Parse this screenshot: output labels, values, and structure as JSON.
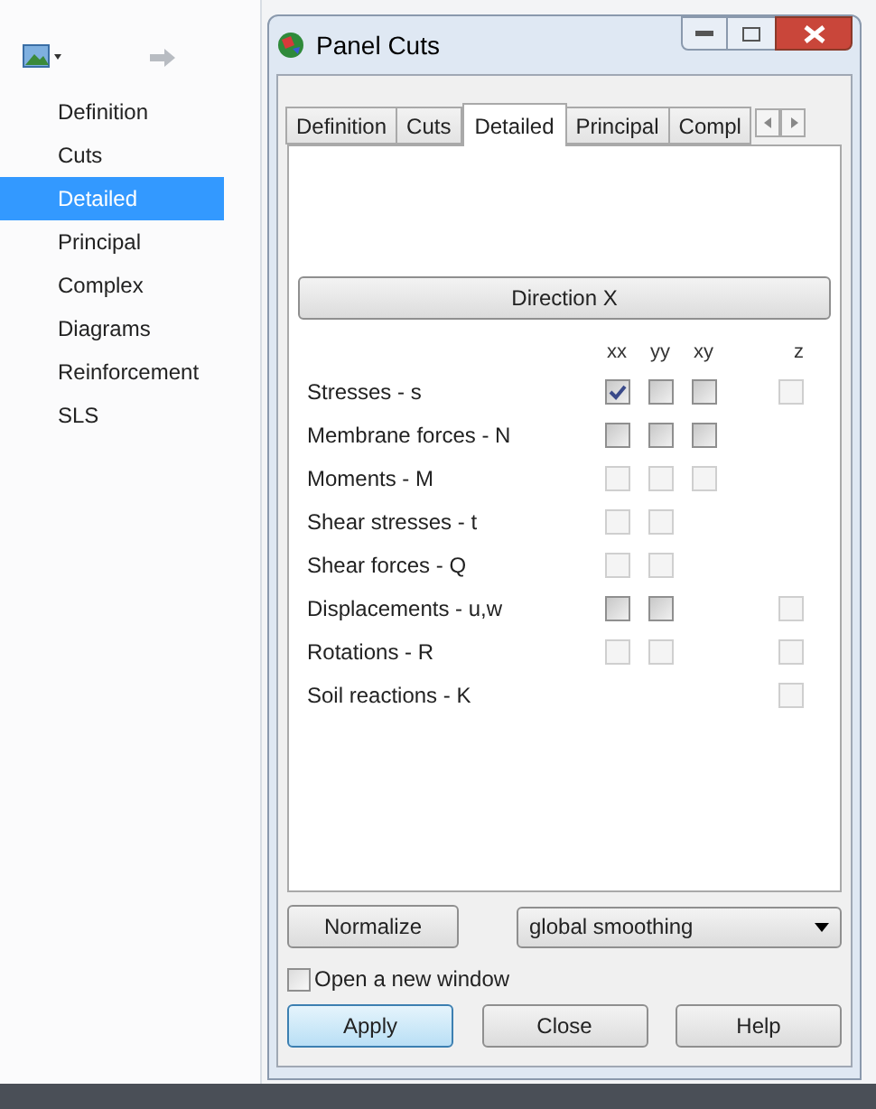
{
  "sidebar": {
    "items": [
      {
        "label": "Definition",
        "selected": false
      },
      {
        "label": "Cuts",
        "selected": false
      },
      {
        "label": "Detailed",
        "selected": true
      },
      {
        "label": "Principal",
        "selected": false
      },
      {
        "label": "Complex",
        "selected": false
      },
      {
        "label": "Diagrams",
        "selected": false
      },
      {
        "label": "Reinforcement",
        "selected": false
      },
      {
        "label": "SLS",
        "selected": false
      }
    ]
  },
  "window": {
    "title": "Panel Cuts"
  },
  "tabs": [
    {
      "label": "Definition",
      "selected": false
    },
    {
      "label": "Cuts",
      "selected": false
    },
    {
      "label": "Detailed",
      "selected": true
    },
    {
      "label": "Principal",
      "selected": false
    },
    {
      "label": "Compl",
      "selected": false
    }
  ],
  "direction_button": "Direction X",
  "columns": [
    "xx",
    "yy",
    "xy",
    "z"
  ],
  "rows": [
    {
      "label": "Stresses - s",
      "cells": [
        {
          "kind": "checkbox",
          "checked": true,
          "disabled": false
        },
        {
          "kind": "checkbox",
          "checked": false,
          "disabled": false
        },
        {
          "kind": "checkbox",
          "checked": false,
          "disabled": false
        },
        {
          "kind": "checkbox",
          "checked": false,
          "disabled": true
        }
      ]
    },
    {
      "label": "Membrane forces - N",
      "cells": [
        {
          "kind": "checkbox",
          "checked": false,
          "disabled": false
        },
        {
          "kind": "checkbox",
          "checked": false,
          "disabled": false
        },
        {
          "kind": "checkbox",
          "checked": false,
          "disabled": false
        },
        {
          "kind": "none"
        }
      ]
    },
    {
      "label": "Moments - M",
      "cells": [
        {
          "kind": "checkbox",
          "checked": false,
          "disabled": true
        },
        {
          "kind": "checkbox",
          "checked": false,
          "disabled": true
        },
        {
          "kind": "checkbox",
          "checked": false,
          "disabled": true
        },
        {
          "kind": "none"
        }
      ]
    },
    {
      "label": "Shear stresses - t",
      "cells": [
        {
          "kind": "checkbox",
          "checked": false,
          "disabled": true
        },
        {
          "kind": "checkbox",
          "checked": false,
          "disabled": true
        },
        {
          "kind": "none"
        },
        {
          "kind": "none"
        }
      ]
    },
    {
      "label": "Shear forces - Q",
      "cells": [
        {
          "kind": "checkbox",
          "checked": false,
          "disabled": true
        },
        {
          "kind": "checkbox",
          "checked": false,
          "disabled": true
        },
        {
          "kind": "none"
        },
        {
          "kind": "none"
        }
      ]
    },
    {
      "label": "Displacements - u,w",
      "cells": [
        {
          "kind": "checkbox",
          "checked": false,
          "disabled": false
        },
        {
          "kind": "checkbox",
          "checked": false,
          "disabled": false
        },
        {
          "kind": "none"
        },
        {
          "kind": "checkbox",
          "checked": false,
          "disabled": true
        }
      ]
    },
    {
      "label": "Rotations - R",
      "cells": [
        {
          "kind": "checkbox",
          "checked": false,
          "disabled": true
        },
        {
          "kind": "checkbox",
          "checked": false,
          "disabled": true
        },
        {
          "kind": "none"
        },
        {
          "kind": "checkbox",
          "checked": false,
          "disabled": true
        }
      ]
    },
    {
      "label": "Soil reactions - K",
      "cells": [
        {
          "kind": "none"
        },
        {
          "kind": "none"
        },
        {
          "kind": "none"
        },
        {
          "kind": "checkbox",
          "checked": false,
          "disabled": true
        }
      ]
    }
  ],
  "normalize_button": "Normalize",
  "smoothing_dropdown": {
    "value": "global smoothing"
  },
  "open_new_window": {
    "label": "Open a new window",
    "checked": false
  },
  "buttons": [
    {
      "label": "Apply",
      "default": true
    },
    {
      "label": "Close",
      "default": false
    },
    {
      "label": "Help",
      "default": false
    }
  ]
}
